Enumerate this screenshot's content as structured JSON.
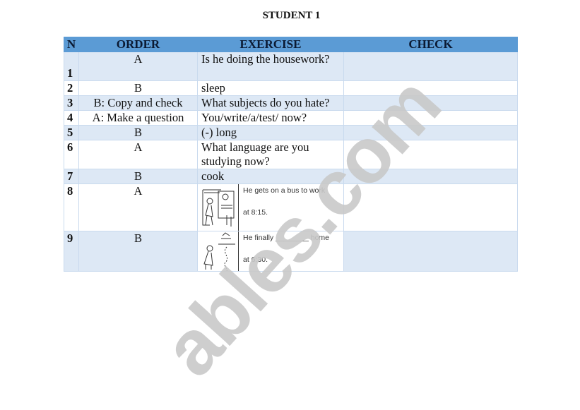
{
  "title": "STUDENT 1",
  "table": {
    "headers": {
      "n": "N",
      "order": "ORDER",
      "exercise": "EXERCISE",
      "check": "CHECK"
    },
    "rows": [
      {
        "n": "1",
        "order": "A",
        "exercise": "Is he doing the housework?",
        "check": ""
      },
      {
        "n": "2",
        "order": "B",
        "exercise": "sleep",
        "check": ""
      },
      {
        "n": "3",
        "order": "B: Copy and check",
        "exercise": "What subjects do you hate?",
        "check": ""
      },
      {
        "n": "4",
        "order": "A: Make a question",
        "exercise": "You/write/a/test/ now?",
        "check": ""
      },
      {
        "n": "5",
        "order": "B",
        "exercise": "(-) long",
        "check": ""
      },
      {
        "n": "6",
        "order": "A",
        "exercise": "What language are you studying now?",
        "check": ""
      },
      {
        "n": "7",
        "order": "B",
        "exercise": "cook",
        "check": ""
      },
      {
        "n": "8",
        "order": "A",
        "exercise_line1": "He gets on a bus to work",
        "exercise_line2": "at 8:15.",
        "image": "man-boarding-bus-illustration",
        "check": ""
      },
      {
        "n": "9",
        "order": "B",
        "exercise_line1": "He finally ________ home",
        "exercise_line2": "at 6:30.",
        "image": "man-walking-home-illustration",
        "check": ""
      }
    ]
  },
  "watermark": "ables.com",
  "colors": {
    "header": "#5b9bd5",
    "alt_row": "#dde8f5",
    "border": "#c9daee"
  }
}
